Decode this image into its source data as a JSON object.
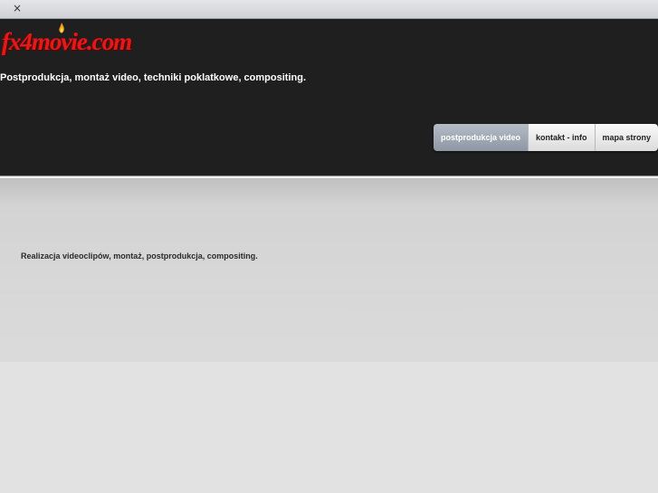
{
  "window": {
    "close_glyph": "×"
  },
  "header": {
    "logo_text": "fx4movie.com",
    "tagline": "Postprodukcja, montaż video, techniki poklatkowe, compositing."
  },
  "nav": {
    "items": [
      {
        "label": "postprodukcja video",
        "active": true
      },
      {
        "label": "kontakt - info",
        "active": false
      },
      {
        "label": "mapa strony",
        "active": false
      }
    ]
  },
  "content": {
    "text": "Realizacja videoclipów, montaż, postprodukcja, compositing."
  },
  "colors": {
    "header_bg": "#1f1f1f",
    "logo_red": "#e31a1a",
    "page_bg": "#e2e2e2",
    "nav_active": "#9aa2ae"
  },
  "icons": {
    "close": "close-icon",
    "flame": "flame-icon"
  }
}
